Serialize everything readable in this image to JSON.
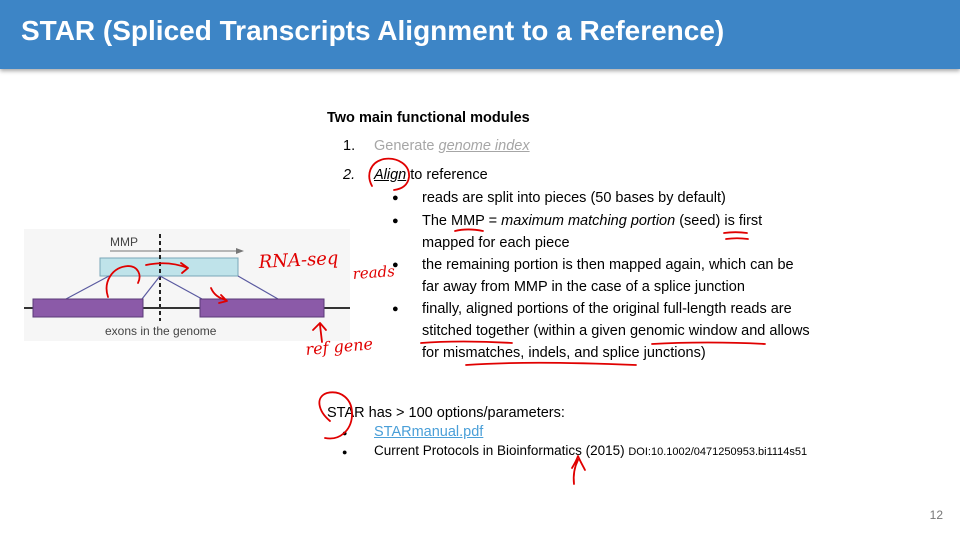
{
  "slide": {
    "title": "STAR (Spliced Transcripts Alignment to a Reference)",
    "page_number": "12"
  },
  "modules": {
    "heading": "Two main functional modules",
    "item1_num": "1.",
    "item1_pre": "Generate ",
    "item1_link": "genome index",
    "item2_num": "2.",
    "item2_word": "Align",
    "item2_rest": " to reference",
    "b1": "reads are split into pieces (50 bases by default)",
    "b2_pre": "The MMP = ",
    "b2_italic": "maximum matching portion",
    "b2_post": " (seed) is first",
    "b2_line2": "mapped for each piece",
    "b3_line1": "the remaining portion is then mapped again, which can be",
    "b3_line2": "far away from MMP in the case of a splice junction",
    "b4_line1": "finally, aligned portions of the original full-length reads are",
    "b4_line2": "stitched together (within a given genomic window and allows",
    "b4_line3": "for mismatches, indels, and splice junctions)"
  },
  "options": {
    "heading": "STAR has > 100 options/parameters:",
    "link": "STARmanual.pdf",
    "ref_main": "Current Protocols in Bioinformatics (2015) ",
    "ref_doi": "DOI:10.1002/0471250953.bi1114s51"
  },
  "diagram": {
    "mmp_label": "MMP",
    "exons_label": "exons in the genome",
    "colors": {
      "read": "#bfe3ea",
      "exon": "#8b5aa8",
      "line": "#5a5aa0"
    }
  },
  "annotations": {
    "rnaseq": "RNA-seq",
    "reads": "reads",
    "refgene": "ref gene",
    "ink_color": "#e00000"
  }
}
